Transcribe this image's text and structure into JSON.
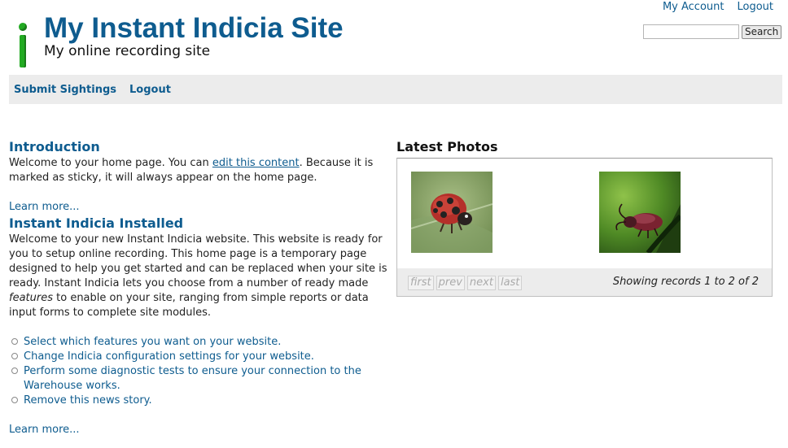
{
  "header": {
    "site_name": "My Instant Indicia Site",
    "slogan": "My online recording site",
    "account_link": "My Account",
    "logout_link": "Logout",
    "search_value": "",
    "search_button": "Search"
  },
  "nav": {
    "items": [
      {
        "label": "Submit Sightings"
      },
      {
        "label": "Logout"
      }
    ]
  },
  "intro": {
    "title": "Introduction",
    "text_before": "Welcome to your home page. You can ",
    "edit_link": "edit this content",
    "text_after": ". Because it is marked as sticky, it will always appear on the home page.",
    "learn_more": "Learn more..."
  },
  "installed": {
    "title": "Instant Indicia Installed",
    "text_before": "Welcome to your new Instant Indicia website. This website is ready for you to setup online recording. This home page is a temporary page designed to help you get started and can be replaced when your site is ready. Instant Indicia lets you choose from a number of ready made ",
    "text_em": "features",
    "text_after": " to enable on your site, ranging from simple reports or data input forms to complete site modules.",
    "links": [
      {
        "label": "Select which features you want on your website."
      },
      {
        "label": "Change Indicia configuration settings for your website."
      },
      {
        "label": "Perform some diagnostic tests to ensure your connection to the Warehouse works."
      },
      {
        "label": "Remove this news story."
      }
    ],
    "learn_more": "Learn more..."
  },
  "photos": {
    "title": "Latest Photos",
    "pager": {
      "first": "first",
      "prev": "prev",
      "next": "next",
      "last": "last",
      "status": "Showing records 1 to 2 of 2"
    }
  },
  "colors": {
    "link": "#0e5c8f",
    "nav_bg": "#ececec",
    "logo_green": "#22aa22"
  }
}
